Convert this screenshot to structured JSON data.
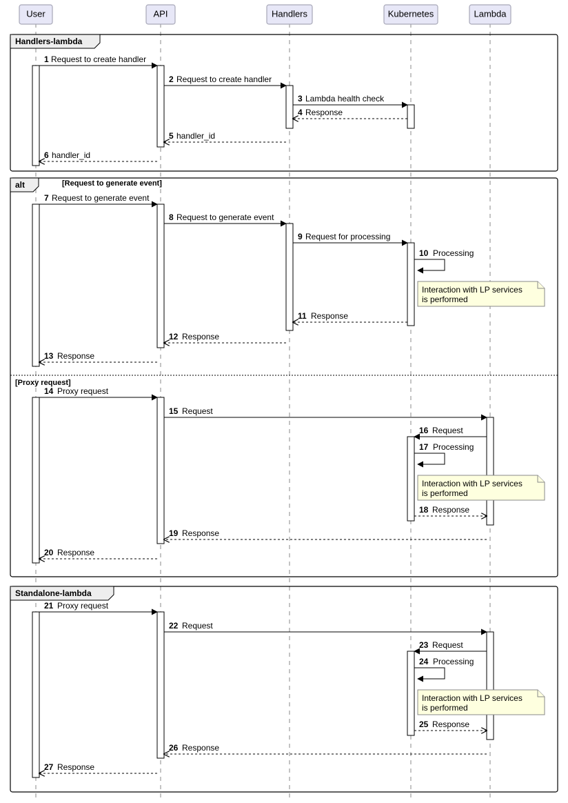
{
  "participants": {
    "user": "User",
    "api": "API",
    "handlers": "Handlers",
    "kubernetes": "Kubernetes",
    "lambda": "Lambda"
  },
  "groups": {
    "handlers_lambda": "Handlers-lambda",
    "alt": "alt",
    "guard1": "[Request to generate event]",
    "guard2": "[Proxy request]",
    "standalone_lambda": "Standalone-lambda"
  },
  "messages": {
    "m1n": "1",
    "m1": "Request to create handler",
    "m2n": "2",
    "m2": "Request to create handler",
    "m3n": "3",
    "m3": "Lambda health check",
    "m4n": "4",
    "m4": "Response",
    "m5n": "5",
    "m5": "handler_id",
    "m6n": "6",
    "m6": "handler_id",
    "m7n": "7",
    "m7": "Request to generate event",
    "m8n": "8",
    "m8": "Request to generate event",
    "m9n": "9",
    "m9": "Request for processing",
    "m10n": "10",
    "m10": "Processing",
    "m11n": "11",
    "m11": "Response",
    "m12n": "12",
    "m12": "Response",
    "m13n": "13",
    "m13": "Response",
    "m14n": "14",
    "m14": "Proxy request",
    "m15n": "15",
    "m15": "Request",
    "m16n": "16",
    "m16": "Request",
    "m17n": "17",
    "m17": "Processing",
    "m18n": "18",
    "m18": "Response",
    "m19n": "19",
    "m19": "Response",
    "m20n": "20",
    "m20": "Response",
    "m21n": "21",
    "m21": "Proxy request",
    "m22n": "22",
    "m22": "Request",
    "m23n": "23",
    "m23": "Request",
    "m24n": "24",
    "m24": "Processing",
    "m25n": "25",
    "m25": "Response",
    "m26n": "26",
    "m26": "Response",
    "m27n": "27",
    "m27": "Response"
  },
  "notes": {
    "n1l1": "Interaction with LP services",
    "n1l2": "is performed",
    "n2l1": "Interaction with LP services",
    "n2l2": "is performed",
    "n3l1": "Interaction with LP services",
    "n3l2": "is performed"
  }
}
